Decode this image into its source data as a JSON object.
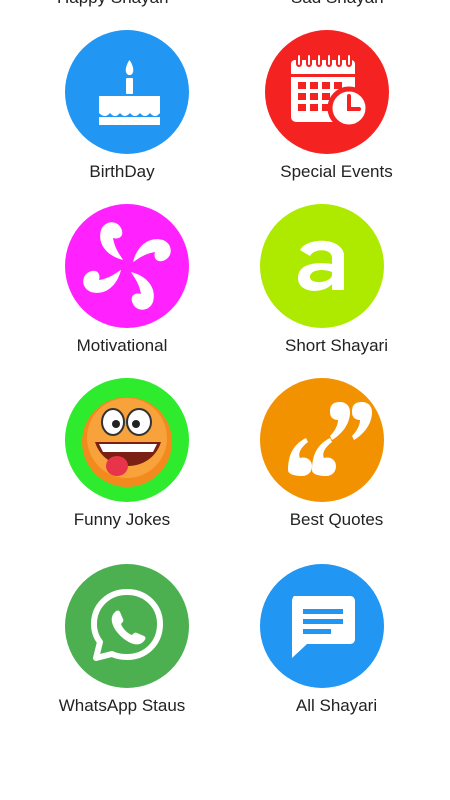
{
  "top_partial": {
    "left_label": "Happy Shayari",
    "right_label": "Sad Shayari"
  },
  "tiles": [
    {
      "label": "BirthDay",
      "color": "#2196F3",
      "icon": "birthday-cake-icon"
    },
    {
      "label": "Special Events",
      "color": "#F52222",
      "icon": "calendar-clock-icon"
    },
    {
      "label": "Motivational",
      "color": "#FF22FF",
      "icon": "pinwheel-icon"
    },
    {
      "label": "Short Shayari",
      "color": "#AEEA00",
      "icon": "letter-a-icon"
    },
    {
      "label": "Funny Jokes",
      "color": "#2EEB2E",
      "icon": "funny-face-icon"
    },
    {
      "label": "Best Quotes",
      "color": "#F39200",
      "icon": "quote-marks-icon"
    },
    {
      "label": "WhatsApp Staus",
      "color": "#4CAF50",
      "icon": "whatsapp-icon"
    },
    {
      "label": "All Shayari",
      "color": "#2196F3",
      "icon": "message-icon"
    }
  ]
}
